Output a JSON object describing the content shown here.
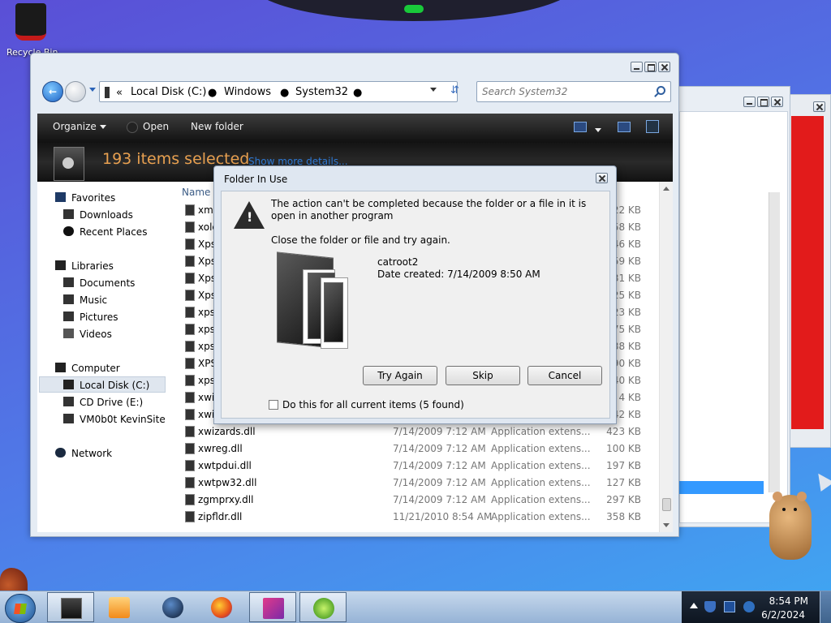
{
  "desktop": {
    "recycle_label": "Recycle Bin"
  },
  "explorer": {
    "breadcrumb": [
      "Local Disk (C:)",
      "Windows",
      "System32"
    ],
    "search_placeholder": "Search System32",
    "toolbar": {
      "organize": "Organize",
      "open": "Open",
      "new_folder": "New folder"
    },
    "details": {
      "selected_count": "193 items selected",
      "show_more": "Show more details..."
    },
    "nav": {
      "favorites": "Favorites",
      "downloads": "Downloads",
      "recent": "Recent Places",
      "libraries": "Libraries",
      "documents": "Documents",
      "music": "Music",
      "pictures": "Pictures",
      "videos": "Videos",
      "computer": "Computer",
      "local_disk": "Local Disk (C:)",
      "cd_drive": "CD Drive (E:)",
      "vm": "VM0b0t KevinSite",
      "network": "Network"
    },
    "column_name": "Name",
    "files": [
      {
        "name": "xml",
        "date": "",
        "type": "",
        "size": "22 KB"
      },
      {
        "name": "xole",
        "date": "",
        "type": "",
        "size": "58 KB"
      },
      {
        "name": "Xps",
        "date": "",
        "type": "",
        "size": "46 KB"
      },
      {
        "name": "Xps",
        "date": "",
        "type": "",
        "size": "59 KB"
      },
      {
        "name": "Xps",
        "date": "",
        "type": "",
        "size": "31 KB"
      },
      {
        "name": "Xps",
        "date": "",
        "type": "",
        "size": "25 KB"
      },
      {
        "name": "xps",
        "date": "",
        "type": "",
        "size": "23 KB"
      },
      {
        "name": "xps",
        "date": "",
        "type": "",
        "size": "75 KB"
      },
      {
        "name": "xps",
        "date": "",
        "type": "",
        "size": "38 KB"
      },
      {
        "name": "XPS",
        "date": "",
        "type": "",
        "size": "90 KB"
      },
      {
        "name": "xps",
        "date": "",
        "type": "",
        "size": "40 KB"
      },
      {
        "name": "xwiz",
        "date": "",
        "type": "",
        "size": "4 KB"
      },
      {
        "name": "xwiz",
        "date": "",
        "type": "",
        "size": "42 KB"
      },
      {
        "name": "xwizards.dll",
        "date": "7/14/2009 7:12 AM",
        "type": "Application extens...",
        "size": "423 KB"
      },
      {
        "name": "xwreg.dll",
        "date": "7/14/2009 7:12 AM",
        "type": "Application extens...",
        "size": "100 KB"
      },
      {
        "name": "xwtpdui.dll",
        "date": "7/14/2009 7:12 AM",
        "type": "Application extens...",
        "size": "197 KB"
      },
      {
        "name": "xwtpw32.dll",
        "date": "7/14/2009 7:12 AM",
        "type": "Application extens...",
        "size": "127 KB"
      },
      {
        "name": "zgmprxy.dll",
        "date": "7/14/2009 7:12 AM",
        "type": "Application extens...",
        "size": "297 KB"
      },
      {
        "name": "zipfldr.dll",
        "date": "11/21/2010 8:54 AM",
        "type": "Application extens...",
        "size": "358 KB"
      }
    ]
  },
  "dialog": {
    "title": "Folder In Use",
    "message": "The action can't be completed because the folder or a file in it is open in another program",
    "instruction": "Close the folder or file and try again.",
    "item_name": "catroot2",
    "item_date": "Date created: 7/14/2009 8:50 AM",
    "try_again": "Try Again",
    "skip": "Skip",
    "cancel": "Cancel",
    "checkbox_label": "Do this for all current items (5 found)"
  },
  "taskbar": {
    "time": "8:54 PM",
    "date": "6/2/2024"
  }
}
